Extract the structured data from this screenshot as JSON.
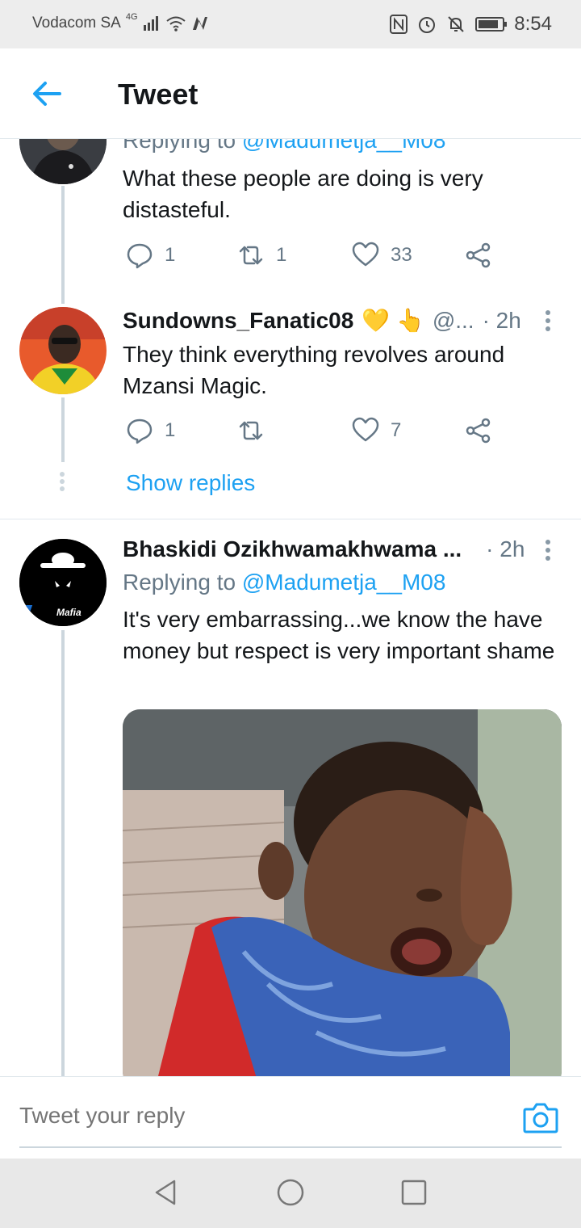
{
  "status_bar": {
    "carrier": "Vodacom SA",
    "network": "4G",
    "time": "8:54",
    "battery_level": 0.85,
    "icons": [
      "signal-icon",
      "wifi-icon",
      "n-app-icon",
      "nfc-icon",
      "alarm-icon",
      "mute-icon",
      "battery-icon"
    ]
  },
  "header": {
    "title": "Tweet",
    "back_icon": "back-arrow-icon"
  },
  "tweets": [
    {
      "replying_to_prefix": "Replying to ",
      "replying_to_handle": "@Madumetja__M08",
      "text": "What these people are doing is very distasteful.",
      "replies": "1",
      "retweets": "1",
      "likes": "33"
    },
    {
      "name": "Sundowns_Fanatic08",
      "emoji": "💛 👆",
      "handle": "@...",
      "time": "· 2h",
      "text": "They think everything revolves around Mzansi Magic.",
      "replies": "1",
      "retweets": "",
      "likes": "7",
      "show_replies": "Show replies"
    },
    {
      "name": "Bhaskidi Ozikhwamakhwama ...",
      "time": "· 2h",
      "replying_to_prefix": "Replying to ",
      "replying_to_handle": "@Madumetja__M08",
      "text": "It's very embarrassing...we know the have money but respect is very important shame",
      "avatar_label": "Mafia"
    }
  ],
  "reply_bar": {
    "placeholder": "Tweet your reply",
    "camera_icon": "camera-icon"
  },
  "colors": {
    "accent": "#1da1f2",
    "secondary_text": "#657786",
    "thread_line": "#ccd6dd"
  }
}
